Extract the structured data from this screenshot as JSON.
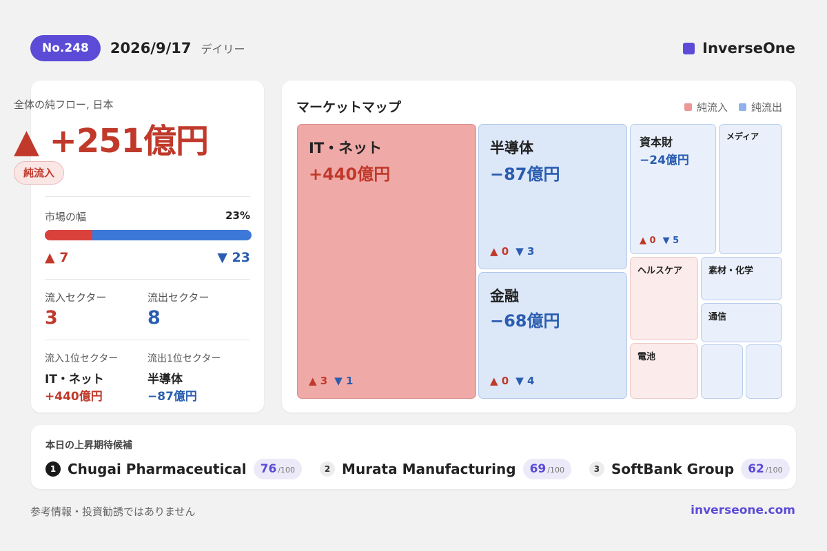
{
  "header": {
    "issue": "No.248",
    "date": "2026/9/17",
    "period": "デイリー",
    "brand": "InverseOne",
    "brand_color": "#5b4bd6"
  },
  "summary": {
    "total_label": "全体の純フロー, 日本",
    "total_value": "▲ +251億円",
    "status_badge": "純流入",
    "breadth_label": "市場の幅",
    "breadth_pct": "23%",
    "breadth_fraction": 0.23,
    "up_count": "▲ 7",
    "down_count": "▼ 23",
    "inflow_sectors_label": "流入セクター",
    "inflow_sectors": "3",
    "outflow_sectors_label": "流出セクター",
    "outflow_sectors": "8",
    "top_inflow_label": "流入1位セクター",
    "top_inflow_name": "IT・ネット",
    "top_inflow_value": "+440億円",
    "top_outflow_label": "流出1位セクター",
    "top_outflow_name": "半導体",
    "top_outflow_value": "−87億円"
  },
  "market_map": {
    "title": "マーケットマップ",
    "legend_in": "純流入",
    "legend_out": "純流出",
    "legend_in_color": "#e99896",
    "legend_out_color": "#8fb2ea",
    "tiles": {
      "it": {
        "name": "IT・ネット",
        "value": "+440億円",
        "up": "▲ 3",
        "down": "▼ 1"
      },
      "semi": {
        "name": "半導体",
        "value": "−87億円",
        "up": "▲ 0",
        "down": "▼ 3"
      },
      "finance": {
        "name": "金融",
        "value": "−68億円",
        "up": "▲ 0",
        "down": "▼ 4"
      },
      "capital": {
        "name": "資本財",
        "value": "−24億円",
        "up": "▲ 0",
        "down": "▼ 5"
      },
      "media": {
        "name": "メディア"
      },
      "health": {
        "name": "ヘルスケア"
      },
      "materials": {
        "name": "素材・化学"
      },
      "telecom": {
        "name": "通信"
      },
      "battery": {
        "name": "電池"
      }
    }
  },
  "candidates": {
    "title": "本日の上昇期待候補",
    "items": [
      {
        "rank": "1",
        "name": "Chugai Pharmaceutical",
        "score": "76",
        "max": "/100"
      },
      {
        "rank": "2",
        "name": "Murata Manufacturing",
        "score": "69",
        "max": "/100"
      },
      {
        "rank": "3",
        "name": "SoftBank Group",
        "score": "62",
        "max": "/100"
      }
    ]
  },
  "footer": {
    "note": "参考情報・投資勧誘ではありません",
    "url": "inverseone.com"
  }
}
